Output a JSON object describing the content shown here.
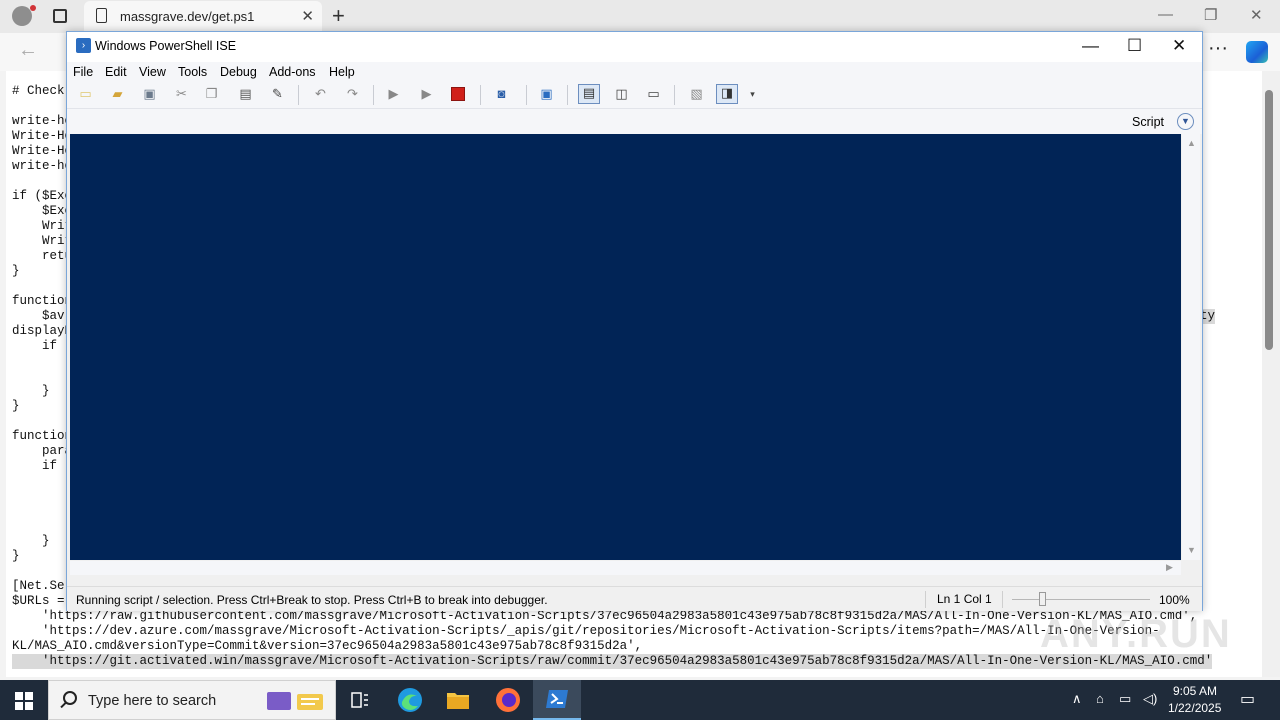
{
  "browser": {
    "tab_title": "massgrave.dev/get.ps1",
    "new_tab": "+",
    "tab_close": "✕",
    "back": "←",
    "more": "···",
    "window_minimize": "—",
    "window_restore": "❐",
    "window_close": "✕"
  },
  "page": {
    "lines": [
      "# Check",
      "write-ho",
      "Write-Ho",
      "Write-Ho",
      "write-ho",
      "if ($Exe",
      "    $Exe",
      "    Writ",
      "    Writ",
      "    retu",
      "}",
      "function",
      "    $avl",
      "displayN",
      "    if (",
      "    }",
      "}",
      "function",
      "    para",
      "    if (",
      "    }",
      "}",
      "[Net.Ser",
      "$URLs = ",
      "    'https://raw.githubusercontent.com/massgrave/Microsoft-Activation-Scripts/37ec96504a2983a5801c43e975ab78c8f9315d2a/MAS/All-In-One-Version-KL/MAS_AIO.cmd',",
      "    'https://dev.azure.com/massgrave/Microsoft-Activation-Scripts/_apis/git/repositories/Microsoft-Activation-Scripts/items?path=/MAS/All-In-One-Version-",
      "KL/MAS_AIO.cmd&versionType=Commit&version=37ec96504a2983a5801c43e975ab78c8f9315d2a',",
      "    'https://git.activated.win/massgrave/Microsoft-Activation-Scripts/raw/commit/37ec96504a2983a5801c43e975ab78c8f9315d2a/MAS/All-In-One-Version-KL/MAS_AIO.cmd'"
    ],
    "right_fragment": "ty"
  },
  "ise": {
    "title": "Windows PowerShell ISE",
    "menu": [
      "File",
      "Edit",
      "View",
      "Tools",
      "Debug",
      "Add-ons",
      "Help"
    ],
    "script_label": "Script",
    "status_text": "Running script / selection.  Press Ctrl+Break to stop.  Press Ctrl+B to break into debugger.",
    "position": "Ln 1  Col 1",
    "zoom": "100%",
    "console_bg": "#012456"
  },
  "watermark": "ANY.RUN",
  "taskbar": {
    "search_placeholder": "Type here to search",
    "time": "9:05 AM",
    "date": "1/22/2025"
  }
}
